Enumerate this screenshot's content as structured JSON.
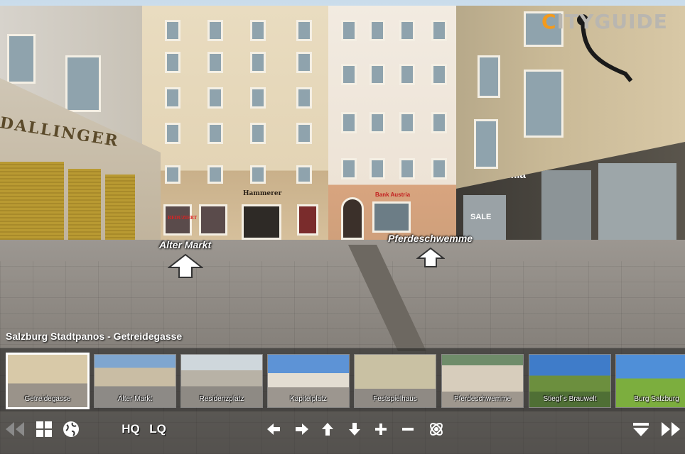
{
  "logo": {
    "first_letter": "C",
    "rest": "ITYGUIDE"
  },
  "signs": {
    "left_shop": "DALLINGER",
    "right_shop": "mia",
    "center_shop": "Hammerer",
    "bank": "Bank Austria",
    "sale": "SALE",
    "reduziert": "REDUZIERT"
  },
  "hotspots": [
    {
      "label": "Alter Markt"
    },
    {
      "label": "Pferdeschwemme"
    }
  ],
  "title": "Salzburg Stadtpanos - Getreidegasse",
  "thumbnails": [
    {
      "label": "Getreidegasse",
      "active": true
    },
    {
      "label": "Alter Markt",
      "active": false
    },
    {
      "label": "Residenzplatz",
      "active": false
    },
    {
      "label": "Kapitelplatz",
      "active": false
    },
    {
      "label": "Festspielhaus",
      "active": false
    },
    {
      "label": "Pferdeschwemme",
      "active": false
    },
    {
      "label": "Stiegl´s Brauwelt",
      "active": false
    },
    {
      "label": "Burg Salzburg",
      "active": false
    }
  ],
  "controls": {
    "hq_label": "HQ",
    "lq_label": "LQ"
  },
  "icons": {
    "first": "rewind-icon",
    "grid": "grid-icon",
    "globe": "globe-icon",
    "left": "arrow-left-icon",
    "right": "arrow-right-icon",
    "up": "arrow-up-icon",
    "down": "arrow-down-icon",
    "zoom_in": "plus-icon",
    "zoom_out": "minus-icon",
    "gyro": "gyroscope-icon",
    "hide": "hide-bar-icon",
    "next": "fast-forward-icon"
  },
  "colors": {
    "logo_accent": "#f39a1c",
    "logo_text": "#b9b6b0",
    "active_border": "#ffffff"
  }
}
